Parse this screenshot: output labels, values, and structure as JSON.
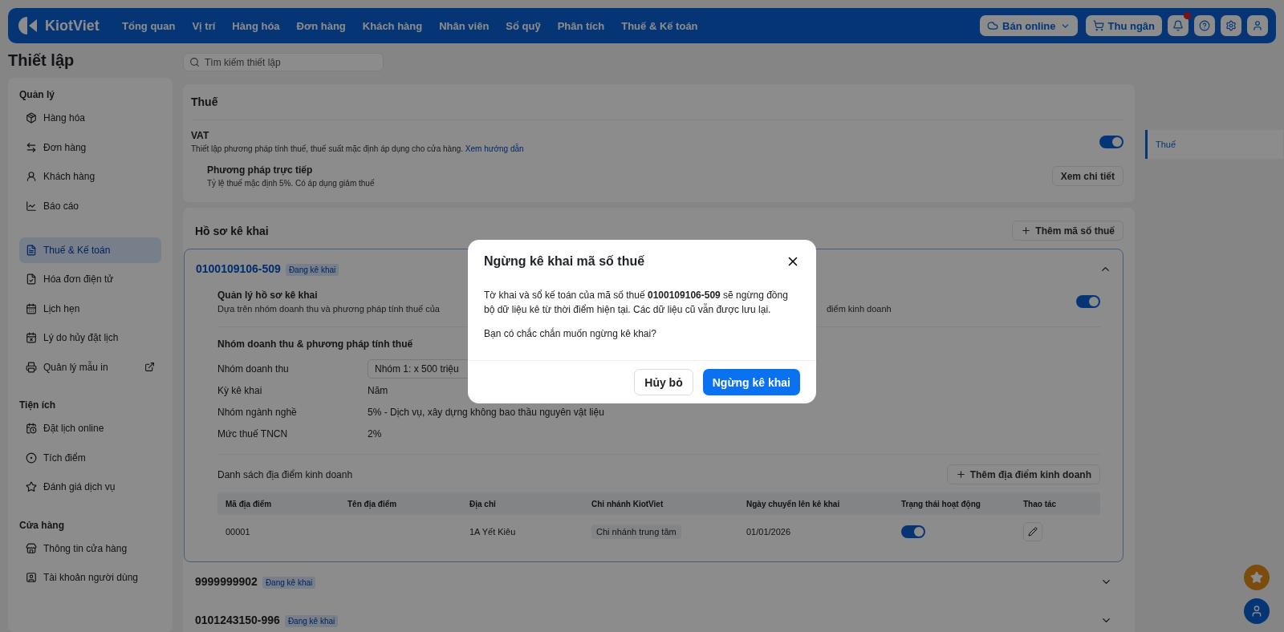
{
  "nav": {
    "logo": "KiotViet",
    "items": [
      "Tổng quan",
      "Vị trí",
      "Hàng hóa",
      "Đơn hàng",
      "Khách hàng",
      "Nhân viên",
      "Sổ quỹ",
      "Phân tích",
      "Thuế & Kế toán"
    ],
    "online_button": "Bán online",
    "cashier_button": "Thu ngân"
  },
  "page_title": "Thiết lập",
  "search": {
    "placeholder": "Tìm kiếm thiết lập"
  },
  "sidebar": {
    "sections": [
      {
        "title": "Quản lý",
        "items": [
          {
            "label": "Hàng hóa",
            "selected": false
          },
          {
            "label": "Đơn hàng",
            "selected": false
          },
          {
            "label": "Khách hàng",
            "selected": false
          },
          {
            "label": "Báo cáo",
            "selected": false
          }
        ]
      },
      {
        "items": [
          {
            "label": "Thuế & Kế toán",
            "selected": true
          },
          {
            "label": "Hóa đơn điện tử",
            "selected": false
          },
          {
            "label": "Lịch hẹn",
            "selected": false
          },
          {
            "label": "Lý do hủy đặt lịch",
            "selected": false
          },
          {
            "label": "Quản lý mẫu in",
            "selected": false,
            "external": true
          }
        ]
      },
      {
        "title": "Tiện ích",
        "items": [
          {
            "label": "Đặt lịch online",
            "selected": false
          },
          {
            "label": "Tích điểm",
            "selected": false
          },
          {
            "label": "Đánh giá dịch vụ",
            "selected": false
          }
        ]
      },
      {
        "title": "Cửa hàng",
        "items": [
          {
            "label": "Thông tin cửa hàng",
            "selected": false
          },
          {
            "label": "Tài khoản người dùng",
            "selected": false
          }
        ]
      }
    ]
  },
  "tax_card": {
    "title": "Thuế",
    "vat_label": "VAT",
    "vat_description": "Thiết lập phương pháp tính thuế, thuế suất mặc định áp dụng cho cửa hàng.",
    "vat_link": "Xem hướng dẫn",
    "vat_on": true,
    "method_title": "Phương pháp trực tiếp",
    "method_description": "Tỷ lệ thuế mặc định 5%. Có áp dụng giảm thuế",
    "details_button": "Xem chi tiết"
  },
  "profiles_section": {
    "title": "Hồ sơ kê khai",
    "add_button": "Thêm mã số thuế",
    "profiles": [
      {
        "code": "0100109106-509",
        "badge": "Đang kê khai",
        "expanded": true,
        "manage_title": "Quản lý hồ sơ kê khai",
        "manage_description": "Dựa trên nhóm doanh thu và phương pháp tính thuế của",
        "manage_description_end": "điểm kinh doanh",
        "manage_on": true,
        "group_title": "Nhóm doanh thu & phương pháp tính thuế",
        "fields": [
          {
            "kind": "select",
            "label": "Nhóm doanh thu",
            "value": "Nhóm 1: x 500 triệu"
          },
          {
            "kind": "text",
            "label": "Kỳ kê khai",
            "value": "Năm"
          },
          {
            "kind": "text",
            "label": "Nhóm ngành nghề",
            "value": "5% - Dịch vụ, xây dựng không bao thầu nguyên vật liệu"
          },
          {
            "kind": "text",
            "label": "Mức thuế TNCN",
            "value": "2%"
          }
        ],
        "locations_title": "Danh sách địa điểm kinh doanh",
        "add_location_button": "Thêm địa điểm kinh doanh",
        "table": {
          "columns": [
            "Mã địa điểm",
            "Tên địa điểm",
            "Địa chỉ",
            "Chi nhánh KiotViet",
            "Ngày chuyển lên kê khai",
            "Trạng thái hoạt động",
            "Thao tác"
          ],
          "rows": [
            {
              "code": "00001",
              "address": "1A Yết Kiêu",
              "branch": "Chi nhánh trung tâm",
              "date": "01/01/2026",
              "active": true
            }
          ]
        }
      },
      {
        "code": "9999999902",
        "badge": "Đang kê khai",
        "expanded": false
      },
      {
        "code": "0101243150-996",
        "badge": "Đang kê khai",
        "expanded": false
      }
    ]
  },
  "right_nav": [
    {
      "label": "Thuế",
      "selected": true
    }
  ],
  "dialog": {
    "title": "Ngừng kê khai mã số thuế",
    "message": "Tờ khai và sổ kế toán của mã số thuế **0100109106-509** sẽ ngừng đồng bộ dữ liệu kê từ thời điểm hiện tại. Các dữ liệu cũ vẫn được lưu lại.",
    "question": "Bạn có chắc chắn muốn ngừng kê khai?",
    "cancel_button": "Hủy bỏ",
    "confirm_button": "Ngừng kê khai"
  }
}
